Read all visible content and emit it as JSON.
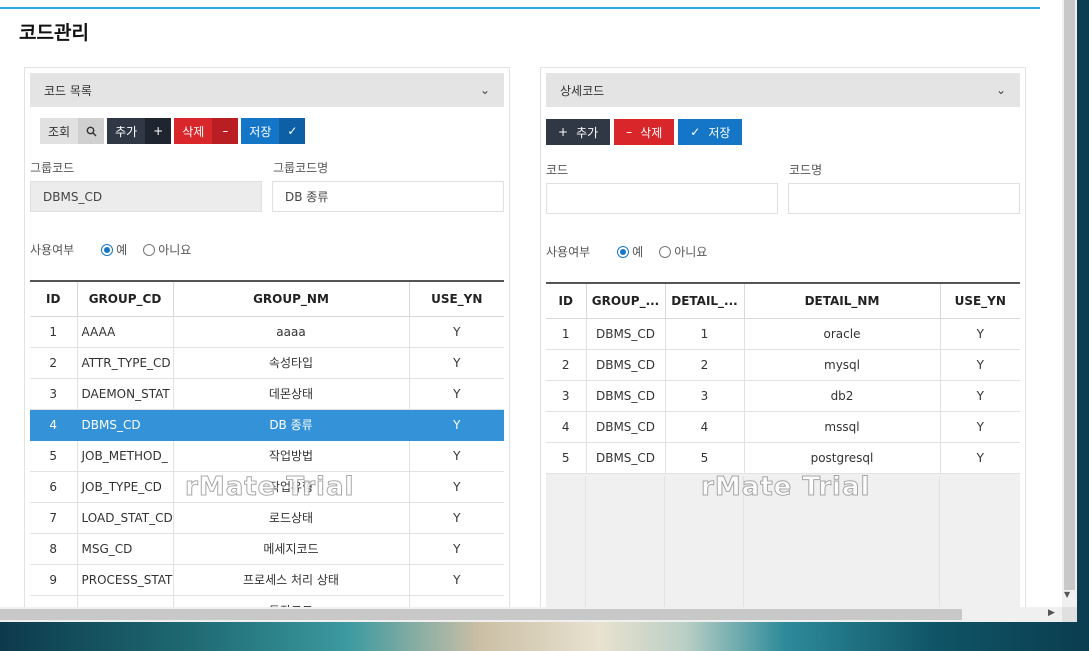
{
  "page": {
    "title": "코드관리"
  },
  "left": {
    "header": "코드 목록",
    "buttons": {
      "search": "조회",
      "add": "추가",
      "delete": "삭제",
      "save": "저장"
    },
    "group_code_label": "그룹코드",
    "group_code_value": "DBMS_CD",
    "group_name_label": "그룹코드명",
    "group_name_value": "DB 종류",
    "use_label": "사용여부",
    "use_yes": "예",
    "use_no": "아니요",
    "columns": [
      "ID",
      "GROUP_CD",
      "GROUP_NM",
      "USE_YN"
    ],
    "rows": [
      [
        "1",
        "AAAA",
        "aaaa",
        "Y"
      ],
      [
        "2",
        "ATTR_TYPE_CD",
        "속성타입",
        "Y"
      ],
      [
        "3",
        "DAEMON_STAT",
        "데몬상태",
        "Y"
      ],
      [
        "4",
        "DBMS_CD",
        "DB 종류",
        "Y"
      ],
      [
        "5",
        "JOB_METHOD_",
        "작업방법",
        "Y"
      ],
      [
        "6",
        "JOB_TYPE_CD",
        "작업유형",
        "Y"
      ],
      [
        "7",
        "LOAD_STAT_CD",
        "로드상태",
        "Y"
      ],
      [
        "8",
        "MSG_CD",
        "메세지코드",
        "Y"
      ],
      [
        "9",
        "PROCESS_STAT",
        "프로세스 처리 상태",
        "Y"
      ],
      [
        "",
        "",
        "동작코드",
        ""
      ]
    ],
    "selected_row": 3,
    "watermark": "rMate Trial"
  },
  "right": {
    "header": "상세코드",
    "buttons": {
      "add": "추가",
      "delete": "삭제",
      "save": "저장"
    },
    "code_label": "코드",
    "code_value": "",
    "name_label": "코드명",
    "name_value": "",
    "use_label": "사용여부",
    "use_yes": "예",
    "use_no": "아니요",
    "columns": [
      "ID",
      "GROUP_...",
      "DETAIL_...",
      "DETAIL_NM",
      "USE_YN"
    ],
    "rows": [
      [
        "1",
        "DBMS_CD",
        "1",
        "oracle",
        "Y"
      ],
      [
        "2",
        "DBMS_CD",
        "2",
        "mysql",
        "Y"
      ],
      [
        "3",
        "DBMS_CD",
        "3",
        "db2",
        "Y"
      ],
      [
        "4",
        "DBMS_CD",
        "4",
        "mssql",
        "Y"
      ],
      [
        "5",
        "DBMS_CD",
        "5",
        "postgresql",
        "Y"
      ]
    ],
    "watermark": "rMate Trial"
  },
  "colors": {
    "accent": "#29a9e1",
    "selected": "#3492d8",
    "dark": "#303846",
    "red": "#d9262b",
    "blue": "#1576c7"
  }
}
